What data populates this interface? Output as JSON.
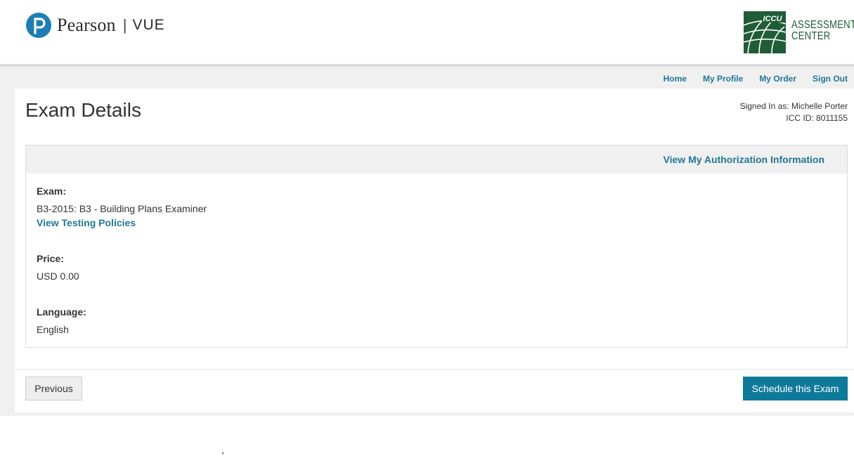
{
  "header": {
    "pearson_word": "Pearson",
    "pearson_separator": "|",
    "pearson_vue": "VUE",
    "icc_badge": "ICCU",
    "icc_line1": "ASSESSMENT",
    "icc_line2": "CENTER"
  },
  "nav": {
    "home": "Home",
    "my_profile": "My Profile",
    "my_order": "My Order",
    "sign_out": "Sign Out"
  },
  "page": {
    "title": "Exam Details",
    "signed_in": "Signed In as: Michelle Porter",
    "icc_id": "ICC ID: 8011155"
  },
  "card": {
    "auth_link": "View My Authorization Information",
    "exam_label": "Exam:",
    "exam_value": "B3-2015: B3 - Building Plans Examiner",
    "policies_link": "View Testing Policies",
    "price_label": "Price:",
    "price_value": "USD 0.00",
    "language_label": "Language:",
    "language_value": "English"
  },
  "buttons": {
    "previous": "Previous",
    "schedule": "Schedule this Exam"
  },
  "colors": {
    "link": "#1e7896",
    "primary_button": "#0e7a9a",
    "icc_green": "#1f5d36",
    "pearson_blue": "#1d7eb5"
  }
}
